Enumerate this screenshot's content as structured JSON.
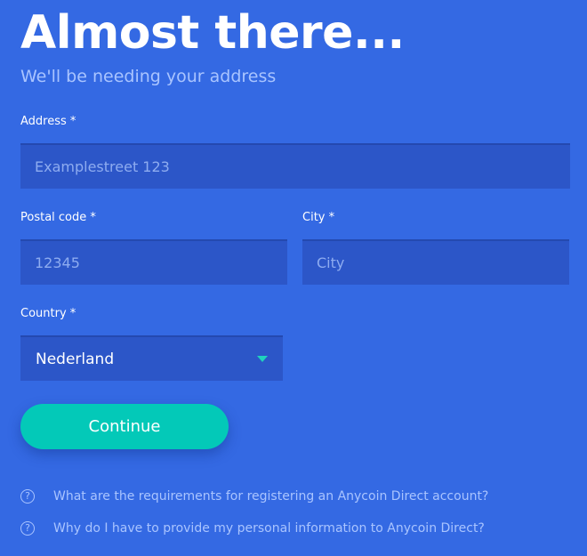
{
  "header": {
    "title": "Almost there...",
    "subtitle": "We'll be needing your address"
  },
  "form": {
    "address": {
      "label": "Address *",
      "placeholder": "Examplestreet 123",
      "value": ""
    },
    "postal_code": {
      "label": "Postal code *",
      "placeholder": "12345",
      "value": ""
    },
    "city": {
      "label": "City *",
      "placeholder": "City",
      "value": ""
    },
    "country": {
      "label": "Country *",
      "selected": "Nederland",
      "icon": "caret-down-icon"
    },
    "continue_label": "Continue"
  },
  "faq": [
    {
      "icon": "question-circle-icon",
      "text": "What are the requirements for registering an Anycoin Direct account?"
    },
    {
      "icon": "question-circle-icon",
      "text": "Why do I have to provide my personal information to Anycoin Direct?"
    }
  ],
  "colors": {
    "background": "#3469e3",
    "field": "#2c56c8",
    "accent": "#03c9b8",
    "muted_text": "#a9c4ff"
  }
}
